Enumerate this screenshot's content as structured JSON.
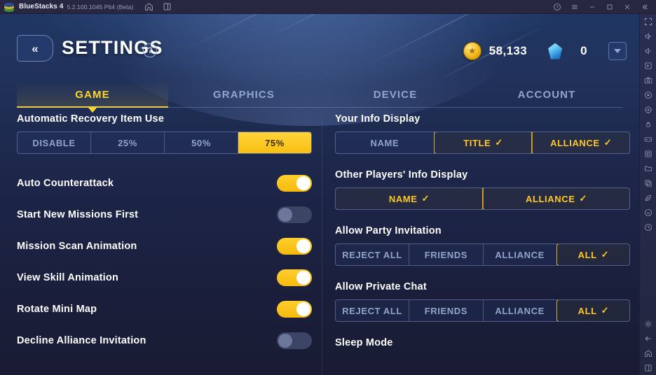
{
  "titlebar": {
    "app_name": "BlueStacks 4",
    "version": "5.2.100.1045 P64 (Beta)",
    "icons": [
      "home-icon",
      "multi-instance-icon"
    ],
    "window_buttons": [
      "help-icon",
      "menu-icon",
      "minimize-icon",
      "maximize-icon",
      "close-icon",
      "collapse-icon"
    ]
  },
  "header": {
    "back_label": "«",
    "title": "SETTINGS",
    "help_label": "?",
    "coins": "58,133",
    "gems": "0"
  },
  "tabs": [
    {
      "label": "GAME",
      "active": true
    },
    {
      "label": "GRAPHICS",
      "active": false
    },
    {
      "label": "DEVICE",
      "active": false
    },
    {
      "label": "ACCOUNT",
      "active": false
    }
  ],
  "left_column": {
    "recovery": {
      "title": "Automatic Recovery Item Use",
      "options": [
        {
          "label": "DISABLE",
          "state": "inactive"
        },
        {
          "label": "25%",
          "state": "inactive"
        },
        {
          "label": "50%",
          "state": "inactive"
        },
        {
          "label": "75%",
          "state": "filled"
        }
      ]
    },
    "toggles": [
      {
        "label": "Auto Counterattack",
        "on": true
      },
      {
        "label": "Start New Missions First",
        "on": false
      },
      {
        "label": "Mission Scan Animation",
        "on": true
      },
      {
        "label": "View Skill Animation",
        "on": true
      },
      {
        "label": "Rotate Mini Map",
        "on": true
      },
      {
        "label": "Decline Alliance Invitation",
        "on": false
      }
    ]
  },
  "right_column": {
    "your_info": {
      "title": "Your Info Display",
      "options": [
        {
          "label": "NAME",
          "state": "inactive"
        },
        {
          "label": "TITLE",
          "state": "outlined"
        },
        {
          "label": "ALLIANCE",
          "state": "outlined"
        }
      ]
    },
    "other_info": {
      "title": "Other Players' Info Display",
      "options": [
        {
          "label": "NAME",
          "state": "outlined"
        },
        {
          "label": "ALLIANCE",
          "state": "outlined"
        }
      ]
    },
    "party_invitation": {
      "title": "Allow Party Invitation",
      "options": [
        {
          "label": "REJECT ALL",
          "state": "inactive"
        },
        {
          "label": "FRIENDS",
          "state": "inactive"
        },
        {
          "label": "ALLIANCE",
          "state": "inactive"
        },
        {
          "label": "ALL",
          "state": "outlined"
        }
      ]
    },
    "private_chat": {
      "title": "Allow Private Chat",
      "options": [
        {
          "label": "REJECT ALL",
          "state": "inactive"
        },
        {
          "label": "FRIENDS",
          "state": "inactive"
        },
        {
          "label": "ALLIANCE",
          "state": "inactive"
        },
        {
          "label": "ALL",
          "state": "outlined"
        }
      ]
    },
    "sleep_mode": {
      "title": "Sleep Mode"
    }
  },
  "check_glyph": "✓",
  "toolbar_icons_top": [
    "fullscreen-icon",
    "volume-up-icon",
    "volume-down-icon",
    "keymapping-icon",
    "screenshot-icon",
    "video-record-icon",
    "location-icon",
    "shake-icon",
    "gamepad-icon",
    "macro-icon",
    "folder-icon",
    "copy-icon",
    "eco-mode-icon",
    "install-apk-icon",
    "clock-icon"
  ],
  "toolbar_icons_bottom": [
    "settings-gear-icon",
    "back-arrow-icon",
    "home-icon",
    "recents-icon"
  ],
  "colors": {
    "accent_yellow": "#ffd630",
    "amber_fill": "#f9bf12",
    "outline_gold": "#e0a92a",
    "text_white": "#ffffff",
    "text_muted": "#8fa3cb",
    "bg_dark": "#191c33",
    "titlebar_bg": "#272742"
  }
}
